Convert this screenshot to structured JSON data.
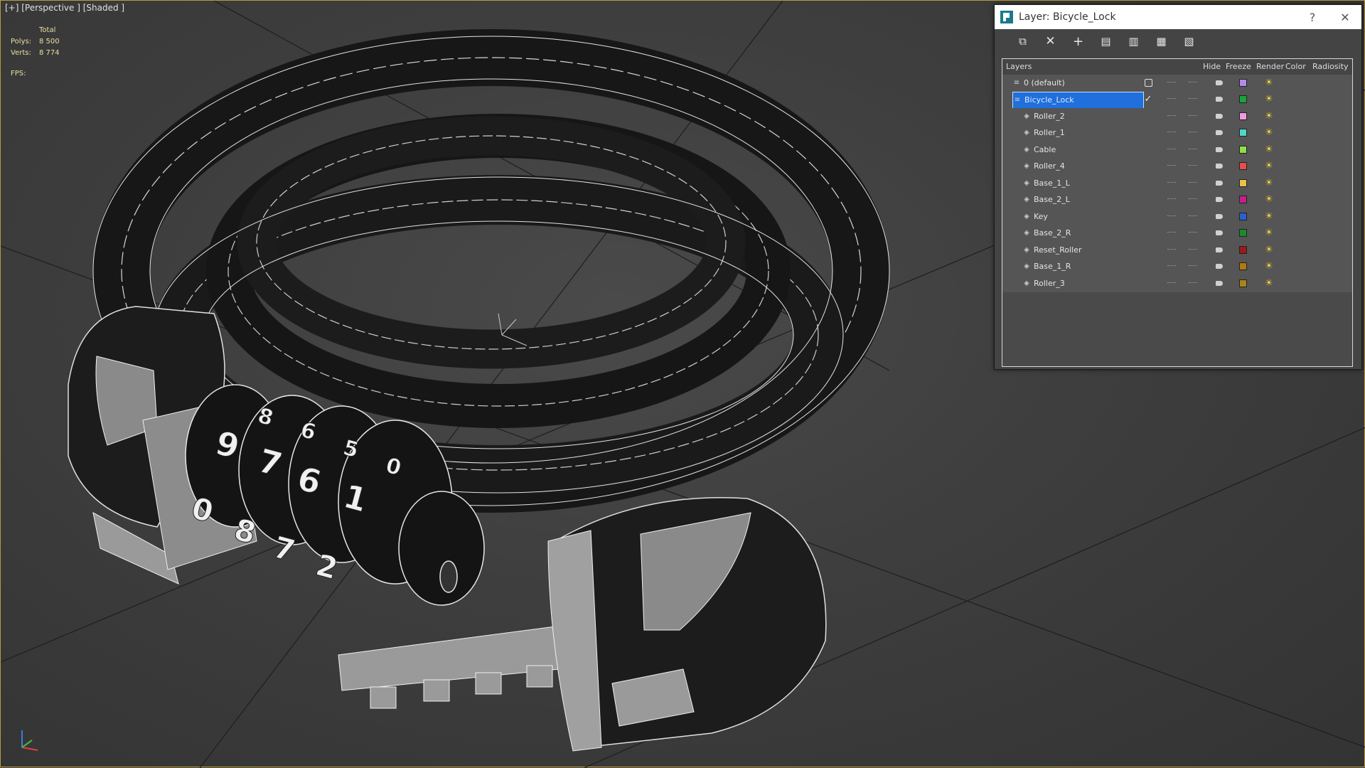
{
  "viewport": {
    "label": "[+] [Perspective ] [Shaded ]",
    "stats": {
      "header": "Total",
      "polys_label": "Polys:",
      "polys_value": "8 500",
      "verts_label": "Verts:",
      "verts_value": "8 774",
      "fps_label": "FPS:"
    },
    "lock_digits": [
      "9",
      "7",
      "6",
      "1",
      "0",
      "8",
      "7",
      "2",
      "8",
      "6",
      "5",
      "0"
    ]
  },
  "dialog": {
    "title": "Layer: Bicycle_Lock",
    "help": "?",
    "close": "✕",
    "tools": [
      "add-to-layer-icon",
      "delete-layer-icon",
      "new-layer-icon",
      "select-objects-icon",
      "select-layer-icon",
      "set-current-layer-icon",
      "hide-all-icon"
    ],
    "columns": {
      "layers": "Layers",
      "hide": "Hide",
      "freeze": "Freeze",
      "render": "Render",
      "color": "Color",
      "radiosity": "Radiosity"
    },
    "rows": [
      {
        "name": "0 (default)",
        "color": "#b48be8",
        "level": 0,
        "current": "box"
      },
      {
        "name": "Bicycle_Lock",
        "color": "#1aa33a",
        "level": 0,
        "selected": true,
        "current": "check"
      },
      {
        "name": "Roller_2",
        "color": "#f29adf",
        "level": 1
      },
      {
        "name": "Roller_1",
        "color": "#4ed8c6",
        "level": 1
      },
      {
        "name": "Cable",
        "color": "#8ee04a",
        "level": 1
      },
      {
        "name": "Roller_4",
        "color": "#e84c4c",
        "level": 1
      },
      {
        "name": "Base_1_L",
        "color": "#e8c24a",
        "level": 1
      },
      {
        "name": "Base_2_L",
        "color": "#c81e8c",
        "level": 1
      },
      {
        "name": "Key",
        "color": "#2a5fd0",
        "level": 1
      },
      {
        "name": "Base_2_R",
        "color": "#1a8c2a",
        "level": 1
      },
      {
        "name": "Reset_Roller",
        "color": "#a01818",
        "level": 1
      },
      {
        "name": "Base_1_R",
        "color": "#b07a10",
        "level": 1
      },
      {
        "name": "Roller_3",
        "color": "#a8841a",
        "level": 1
      }
    ]
  }
}
